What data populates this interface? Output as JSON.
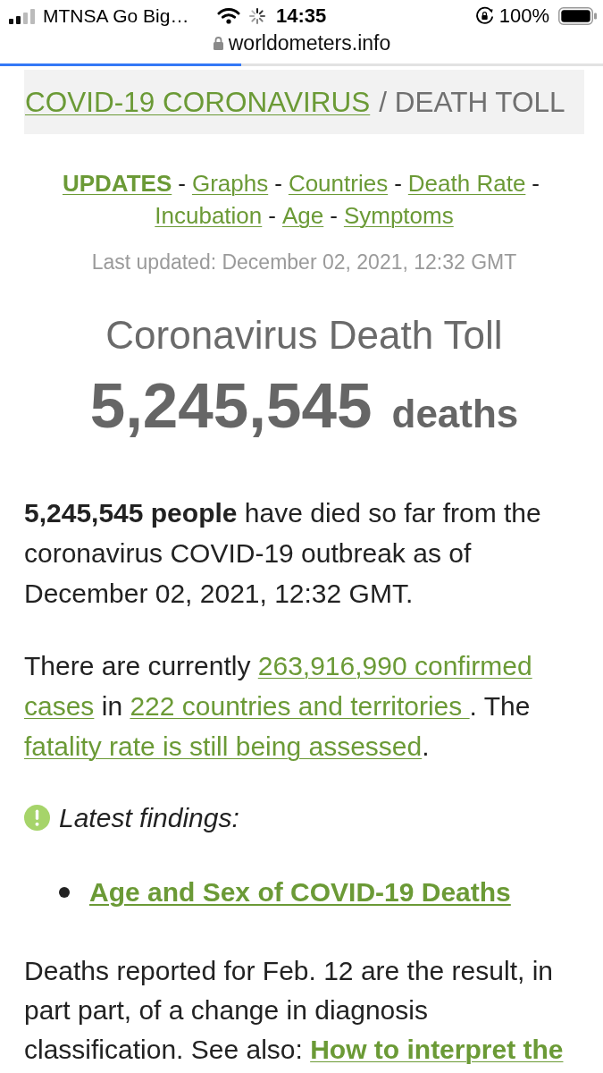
{
  "status_bar": {
    "carrier": "MTNSA Go Big…",
    "time": "14:35",
    "battery": "100%"
  },
  "browser": {
    "url": "worldometers.info",
    "progress": {
      "level": 0.4
    }
  },
  "breadcrumb": {
    "link": "COVID-19 CORONAVIRUS",
    "current": "/ DEATH TOLL"
  },
  "nav": [
    {
      "label": "UPDATES",
      "selected": true,
      "separator": "-"
    },
    {
      "label": "Graphs",
      "selected": false,
      "separator": "-"
    },
    {
      "label": "Countries",
      "selected": false,
      "separator": "-"
    },
    {
      "label": "Death Rate",
      "selected": false,
      "separator": "-"
    },
    {
      "label": "Incubation",
      "selected": false,
      "separator": "-"
    },
    {
      "label": "Age",
      "selected": false,
      "separator": "-"
    },
    {
      "label": "Symptoms",
      "selected": false
    }
  ],
  "last_updated": "Last updated: December 02, 2021, 12:32 GMT",
  "heading": "Coronavirus Death Toll",
  "counter": {
    "value": "5,245,545",
    "unit": "deaths"
  },
  "summary": "**5,245,545 people** have died so far from the coronavirus COVID-19 outbreak as of December 02, 2021, 12:32 GMT.",
  "cases_paragraph": [
    {
      "kind": "text",
      "text": "There are currently "
    },
    {
      "kind": "link",
      "text": "263,916,990 confirmed "
    },
    {
      "kind": "link",
      "text": "cases"
    },
    {
      "kind": "text",
      "text": " in "
    },
    {
      "kind": "link",
      "text": "222 countries and territories "
    },
    {
      "kind": "text",
      "text": ". The "
    },
    {
      "kind": "link",
      "text": "fatality rate is still being assessed"
    },
    {
      "kind": "text",
      "text": "."
    }
  ],
  "findings": {
    "title": "Latest findings:",
    "items": [
      "Age and Sex of COVID-19 Deaths"
    ]
  },
  "note_paragraph": [
    {
      "kind": "text",
      "text": "Deaths reported for Feb. 12 are the result, in part part, of a change in diagnosis classification. See also: "
    },
    {
      "kind": "bold_link",
      "text": "How to interpret the"
    }
  ]
}
